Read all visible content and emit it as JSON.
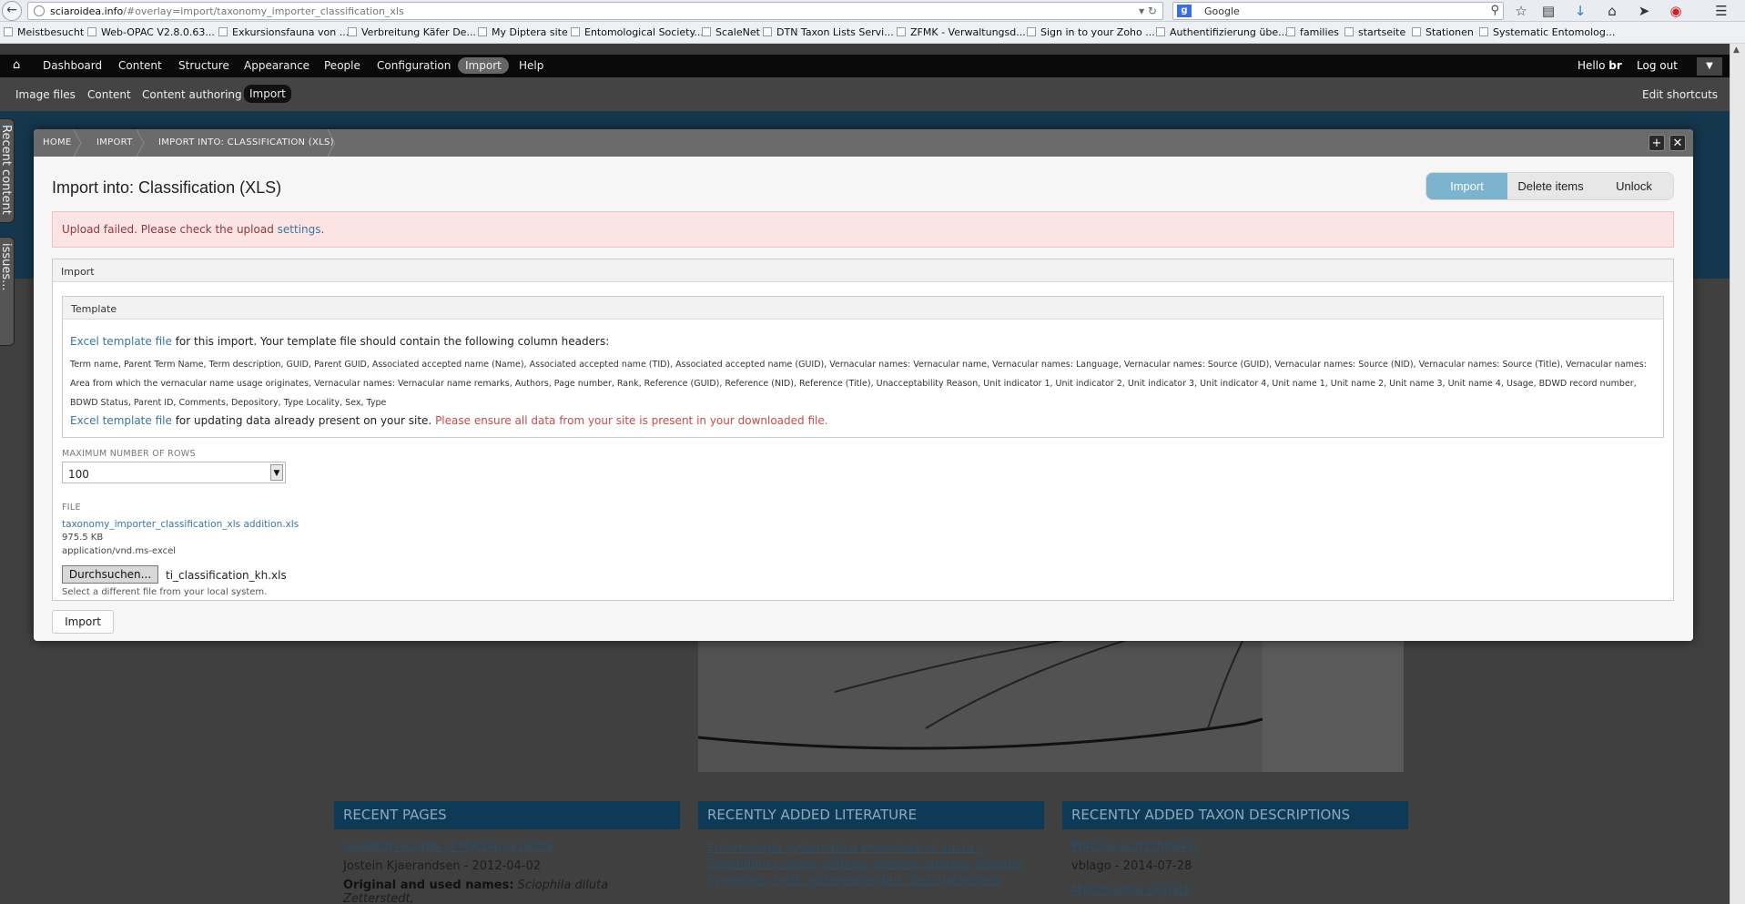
{
  "browser": {
    "url_host": "sciaroidea.info",
    "url_path": "/#overlay=import/taxonomy_importer_classification_xls",
    "search_engine": "Google",
    "search_engine_glyph": "g"
  },
  "bookmarks": [
    "Meistbesucht",
    "Web-OPAC V2.8.0.63...",
    "Exkursionsfauna von ...",
    "Verbreitung Käfer De...",
    "My Diptera site",
    "Entomological Society...",
    "ScaleNet",
    "DTN Taxon Lists Servi...",
    "ZFMK - Verwaltungsd...",
    "Sign in to your Zoho ...",
    "Authentifizierung übe...",
    "families",
    "startseite",
    "Stationen",
    "Systematic Entomolog..."
  ],
  "toolbar": {
    "items": [
      "Dashboard",
      "Content",
      "Structure",
      "Appearance",
      "People",
      "Configuration",
      "Import",
      "Help"
    ],
    "active": "Import",
    "hello": "Hello",
    "user": "br",
    "logout": "Log out"
  },
  "shortcuts": {
    "items": [
      "Image files",
      "Content",
      "Content authoring",
      "Import"
    ],
    "edit": "Edit shortcuts"
  },
  "side_tabs": [
    "Recent content",
    "issues..."
  ],
  "breadcrumb": [
    "HOME",
    "IMPORT",
    "IMPORT INTO: CLASSIFICATION (XLS)"
  ],
  "page": {
    "title": "Import into: Classification (XLS)",
    "action_tabs": [
      "Import",
      "Delete items",
      "Unlock"
    ],
    "error_text": "Upload failed. Please check the upload",
    "error_link": "settings",
    "error_end": "."
  },
  "import_fieldset": {
    "legend": "Import",
    "template_legend": "Template",
    "template_link": "Excel template file",
    "template_text": "for this import. Your template file should contain the following column headers:",
    "column_headers": "Term name, Parent Term Name, Term description, GUID, Parent GUID, Associated accepted name (Name), Associated accepted name (TID), Associated accepted name (GUID), Vernacular names: Vernacular name, Vernacular names: Language, Vernacular names: Source (GUID), Vernacular names: Source (NID), Vernacular names: Source (Title), Vernacular names: Area from which the vernacular name usage originates, Vernacular names: Vernacular name remarks, Authors, Page number, Rank, Reference (GUID), Reference (NID), Reference (Title), Unacceptability Reason, Unit indicator 1, Unit indicator 2, Unit indicator 3, Unit indicator 4, Unit name 1, Unit name 2, Unit name 3, Unit name 4, Usage, BDWD record number, BDWD Status, Parent ID, Comments, Depository, Type Locality, Sex, Type",
    "update_link": "Excel template file",
    "update_text": "for updating data already present on your site.",
    "update_warning": "Please ensure all data from your site is present in your downloaded file.",
    "max_rows_label": "MAXIMUM NUMBER OF ROWS",
    "max_rows_value": "100",
    "file_label": "FILE",
    "file_name": "taxonomy_importer_classification_xls addition.xls",
    "file_size": "975.5 KB",
    "file_mime": "application/vnd.ms-excel",
    "browse_label": "Durchsuchen...",
    "chosen_file": "ti_classification_kh.xls",
    "help_text": "Select a different file from your local system."
  },
  "submit_label": "Import",
  "background": {
    "columns": [
      {
        "heading": "RECENT PAGES",
        "link": "Swedish records of Mycomya diluta",
        "meta": "Jostein Kjaerandsen - 2012-04-02",
        "extra_bold": "Original and used names:",
        "extra": "Sciophila diluta Zetterstedt,"
      },
      {
        "heading": "RECENTLY ADDED LITERATURE",
        "link": "Entomologia systematica emendata et aucta : Secundum classes, ordines, genera, species, adjectis synonimis, locis, observationibus, descriptionibus",
        "meta": "",
        "extra_bold": "",
        "extra": ""
      },
      {
        "heading": "RECENTLY ADDED TAXON DESCRIPTIONS",
        "link": "Phronia portschinskyi",
        "meta": "vblago - 2014-07-28",
        "extra_bold": "",
        "extra": "Mycetophila signata"
      }
    ]
  }
}
